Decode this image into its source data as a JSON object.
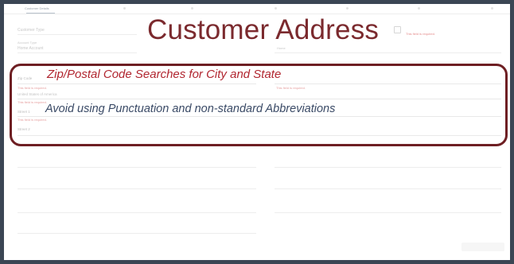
{
  "title": "Customer Address",
  "annotations": {
    "zip_note": "Zip/Postal Code Searches for City and State",
    "punct_note": "Avoid using Punctuation and non-standard Abbreviations"
  },
  "stepper": {
    "steps": [
      "Customer Details",
      "",
      "",
      "",
      "",
      "",
      "",
      ""
    ]
  },
  "form": {
    "customer_type": "Customer Type",
    "account_type_label": "Account Type",
    "account_type_value": "Home Account",
    "zip_label": "Zip Code",
    "zip_required": "This field is required.",
    "city_state_required": "This field is required.",
    "country_value": "United States of America",
    "country_required": "This field is required.",
    "street1_label": "Street 1",
    "street1_required": "This field is required.",
    "street2_label": "Street 2",
    "right_required": "This field is required.",
    "right_select": "Home"
  },
  "colors": {
    "frame_border": "#3b4654",
    "title": "#7b2a2e",
    "highlight_border": "#6e1f23",
    "annotation_red": "#b12630",
    "annotation_blue": "#3a4a66"
  }
}
